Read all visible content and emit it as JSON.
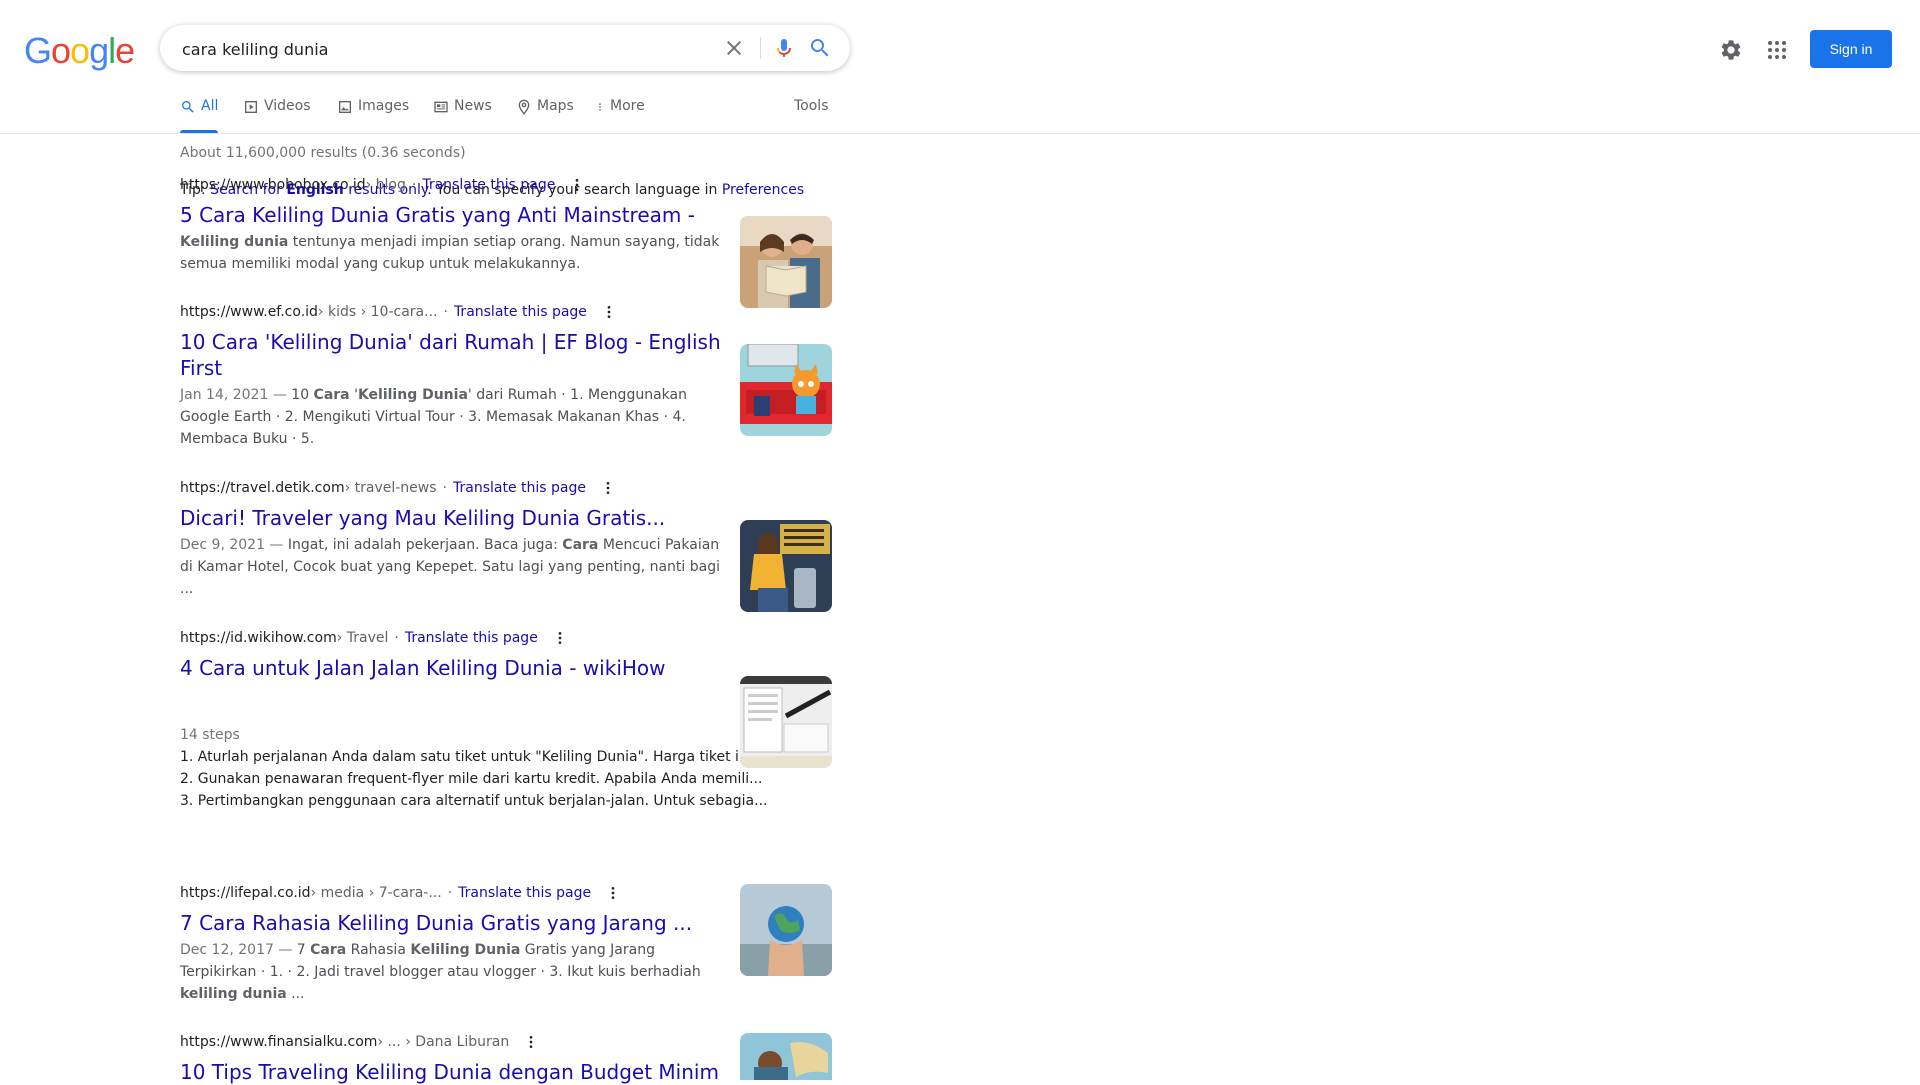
{
  "header": {
    "logo_letters": [
      {
        "ch": "G",
        "color": "#4285f4"
      },
      {
        "ch": "o",
        "color": "#ea4335"
      },
      {
        "ch": "o",
        "color": "#fbbc05"
      },
      {
        "ch": "g",
        "color": "#4285f4"
      },
      {
        "ch": "l",
        "color": "#34a853"
      },
      {
        "ch": "e",
        "color": "#ea4335"
      }
    ],
    "search_query": "cara keliling dunia",
    "sign_in": "Sign in"
  },
  "tabs": [
    {
      "label": "All",
      "icon": "search-icon",
      "active": true
    },
    {
      "label": "Videos",
      "icon": "video-icon",
      "active": false
    },
    {
      "label": "Images",
      "icon": "image-icon",
      "active": false
    },
    {
      "label": "News",
      "icon": "news-icon",
      "active": false
    },
    {
      "label": "Maps",
      "icon": "map-pin-icon",
      "active": false
    },
    {
      "label": "More",
      "icon": "more-vert-icon",
      "active": false
    },
    {
      "label": "Tools",
      "icon": "",
      "active": false
    }
  ],
  "stats": "About 11,600,000 results (0.36 seconds)",
  "tip": {
    "prefix": "Tip: ",
    "link1_a": "Search for ",
    "link1_b": "English",
    "link1_c": " results only",
    "middle": ". You can specify your search language in ",
    "link2": "Preferences"
  },
  "translate_label": "Translate this page",
  "results": [
    {
      "domain": "https://www.bobobox.co.id",
      "path": " › blog",
      "translate": true,
      "title": "5 Cara Keliling Dunia Gratis yang Anti Mainstream -",
      "date": "",
      "snippet_parts": [
        {
          "t": "Keliling dunia",
          "b": true
        },
        {
          "t": " tentunya menjadi impian setiap orang. Namun sayang, tidak semua memiliki modal yang cukup untuk melakukannya.",
          "b": false
        }
      ]
    },
    {
      "domain": "https://www.ef.co.id",
      "path": " › kids › 10-cara...",
      "translate": true,
      "title": "10 Cara 'Keliling Dunia' dari Rumah | EF Blog - English First",
      "date": "Jan 14, 2021 — ",
      "snippet_parts": [
        {
          "t": "10 ",
          "b": false
        },
        {
          "t": "Cara",
          "b": true
        },
        {
          "t": " '",
          "b": false
        },
        {
          "t": "Keliling Dunia",
          "b": true
        },
        {
          "t": "' dari Rumah · 1. Menggunakan Google Earth · 2. Mengikuti Virtual Tour · 3. Memasak Makanan Khas · 4. Membaca Buku · 5.",
          "b": false
        }
      ]
    },
    {
      "domain": "https://travel.detik.com",
      "path": " › travel-news",
      "translate": true,
      "title": "Dicari! Traveler yang Mau Keliling Dunia Gratis...",
      "date": "Dec 9, 2021 — ",
      "snippet_parts": [
        {
          "t": "Ingat, ini adalah pekerjaan. Baca juga: ",
          "b": false
        },
        {
          "t": "Cara",
          "b": true
        },
        {
          "t": " Mencuci Pakaian di Kamar Hotel, Cocok buat yang Kepepet. Satu lagi yang penting, nanti bagi ...",
          "b": false
        }
      ]
    },
    {
      "domain": "https://id.wikihow.com",
      "path": " › Travel",
      "translate": true,
      "title": "4 Cara untuk Jalan Jalan Keliling Dunia - wikiHow",
      "date": "",
      "snippet_parts": [],
      "steps_label": "14 steps",
      "steps": [
        "1.  Aturlah perjalanan Anda dalam satu tiket untuk \"Keliling Dunia\". Harga tiket ini ...",
        "2.  Gunakan penawaran frequent-flyer mile dari kartu kredit. Apabila Anda memili...",
        "3.  Pertimbangkan penggunaan cara alternatif untuk berjalan-jalan. Untuk sebagia..."
      ]
    },
    {
      "domain": "https://lifepal.co.id",
      "path": " › media › 7-cara-...",
      "translate": true,
      "title": "7 Cara Rahasia Keliling Dunia Gratis yang Jarang ...",
      "date": "Dec 12, 2017 — ",
      "snippet_parts": [
        {
          "t": "7 ",
          "b": false
        },
        {
          "t": "Cara",
          "b": true
        },
        {
          "t": " Rahasia ",
          "b": false
        },
        {
          "t": "Keliling Dunia",
          "b": true
        },
        {
          "t": " Gratis yang Jarang Terpikirkan · 1. · 2. Jadi travel blogger atau vlogger · 3. Ikut kuis berhadiah ",
          "b": false
        },
        {
          "t": "keliling dunia",
          "b": true
        },
        {
          "t": " ...",
          "b": false
        }
      ]
    },
    {
      "domain": "https://www.finansialku.com",
      "path": " › ... › Dana Liburan",
      "translate": false,
      "title": "10 Tips Traveling Keliling Dunia dengan Budget Minim",
      "date": "",
      "snippet_parts": []
    }
  ]
}
